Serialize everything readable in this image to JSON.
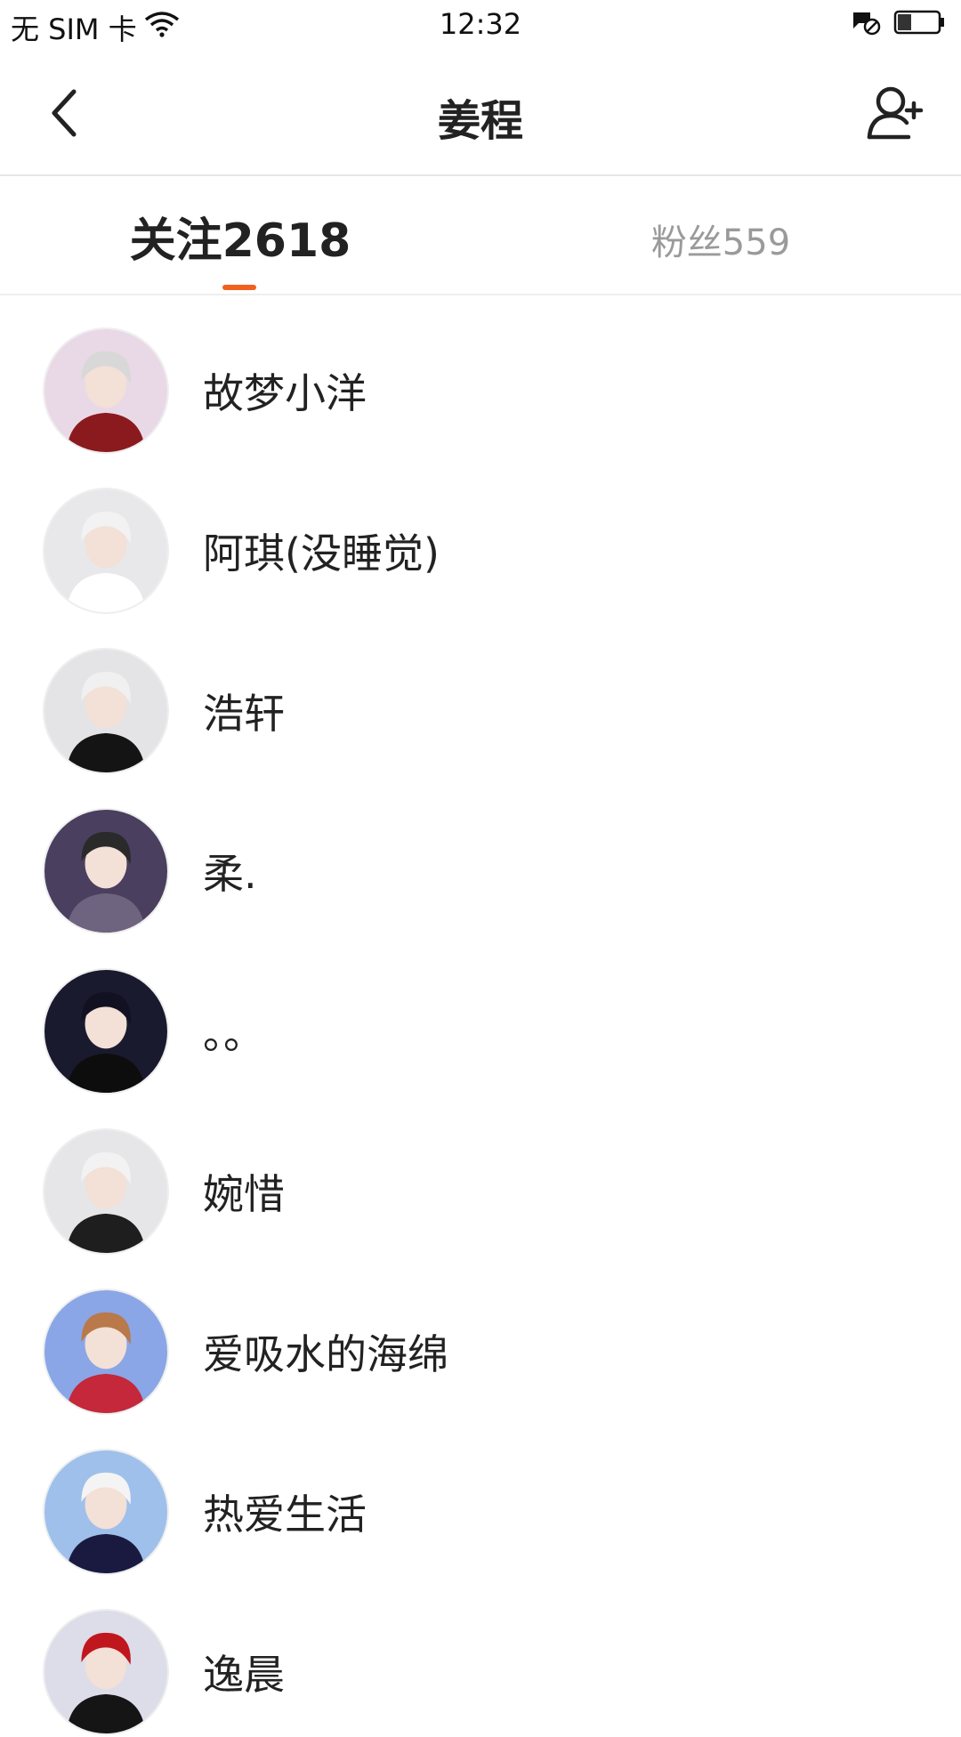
{
  "status_bar": {
    "carrier": "无 SIM 卡",
    "time": "12:32"
  },
  "header": {
    "title": "姜程"
  },
  "tabs": {
    "following": "关注2618",
    "fans": "粉丝559",
    "accent_color": "#f1601f"
  },
  "users": [
    {
      "name": "故梦小洋",
      "bg": "#e9d9e6",
      "hair": "#d8d8d8",
      "cloth": "#8b1a1f"
    },
    {
      "name": "阿琪(没睡觉)",
      "bg": "#e8e8ea",
      "hair": "#f2f2f2",
      "cloth": "#ffffff"
    },
    {
      "name": "浩轩",
      "bg": "#e4e4e6",
      "hair": "#f0f0f0",
      "cloth": "#141414"
    },
    {
      "name": "柔.",
      "bg": "#4a3f5e",
      "hair": "#2a2a2a",
      "cloth": "#6e6480"
    },
    {
      "name": "。。",
      "bg": "#1a1a2e",
      "hair": "#111122",
      "cloth": "#0d0d0d"
    },
    {
      "name": "婉惜",
      "bg": "#e6e6e8",
      "hair": "#f2f2f2",
      "cloth": "#1e1e1e"
    },
    {
      "name": "爱吸水的海绵",
      "bg": "#8aa6e6",
      "hair": "#b9794a",
      "cloth": "#c4283a"
    },
    {
      "name": "热爱生活",
      "bg": "#9fc0ea",
      "hair": "#f4f4f4",
      "cloth": "#1a1a40"
    },
    {
      "name": "逸晨",
      "bg": "#dcdde8",
      "hair": "#c0171f",
      "cloth": "#151515"
    }
  ]
}
